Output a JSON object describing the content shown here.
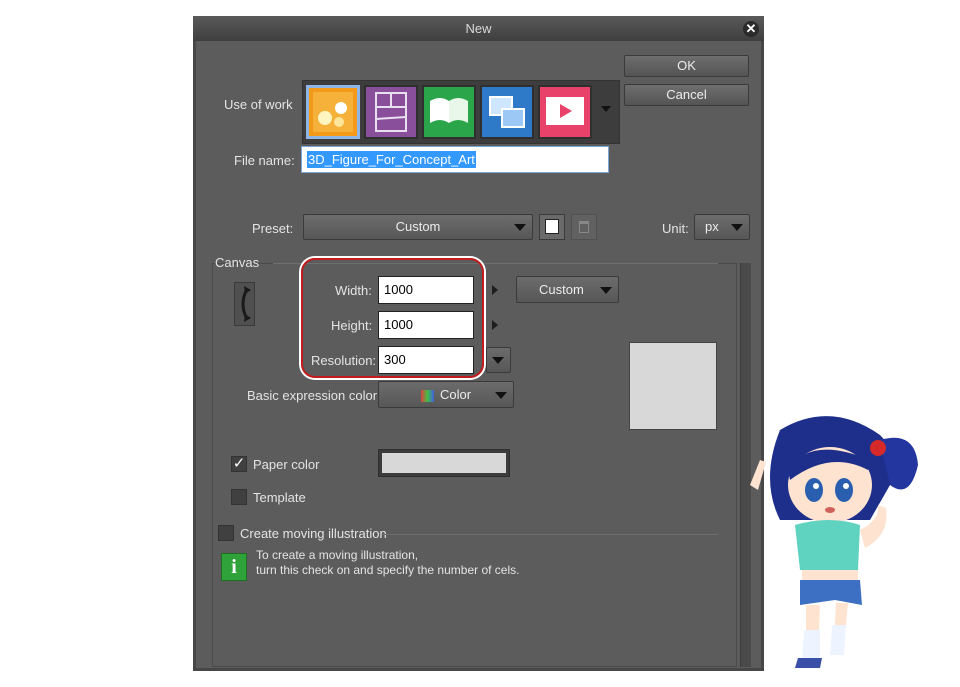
{
  "window": {
    "title": "New",
    "close_label": "✕"
  },
  "use_of_work": {
    "label": "Use of work",
    "icons": [
      {
        "name": "illustration-icon",
        "color": "#f39a1a"
      },
      {
        "name": "comic-icon",
        "color": "#8a4f9a"
      },
      {
        "name": "book-icon",
        "color": "#2aa54a"
      },
      {
        "name": "show-all-comic-settings-icon",
        "color": "#2f7ac8"
      },
      {
        "name": "animation-icon",
        "color": "#e8426a"
      }
    ]
  },
  "buttons": {
    "ok": "OK",
    "cancel": "Cancel"
  },
  "file_name": {
    "label": "File name:",
    "value": "3D_Figure_For_Concept_Art"
  },
  "preset": {
    "label": "Preset:",
    "value": "Custom"
  },
  "unit": {
    "label": "Unit:",
    "value": "px"
  },
  "canvas": {
    "section_label": "Canvas",
    "width": {
      "label": "Width:",
      "value": "1000"
    },
    "height": {
      "label": "Height:",
      "value": "1000"
    },
    "resolution": {
      "label": "Resolution:",
      "value": "300"
    },
    "size_preset": "Custom",
    "basic_expression_color": {
      "label": "Basic expression color:",
      "value": "Color"
    }
  },
  "paper_color": {
    "label": "Paper color",
    "checked": true,
    "check_glyph": "✓",
    "swatch": "#d8d8d8"
  },
  "template": {
    "label": "Template",
    "checked": false
  },
  "moving_illustration": {
    "label": "Create moving illustration",
    "info_icon": "i",
    "info_line1": "To create a moving illustration,",
    "info_line2": "turn this check on and specify the number of cels."
  },
  "colors": {
    "accent_highlight": "#c41c1c",
    "selection": "#8fb4e6"
  }
}
